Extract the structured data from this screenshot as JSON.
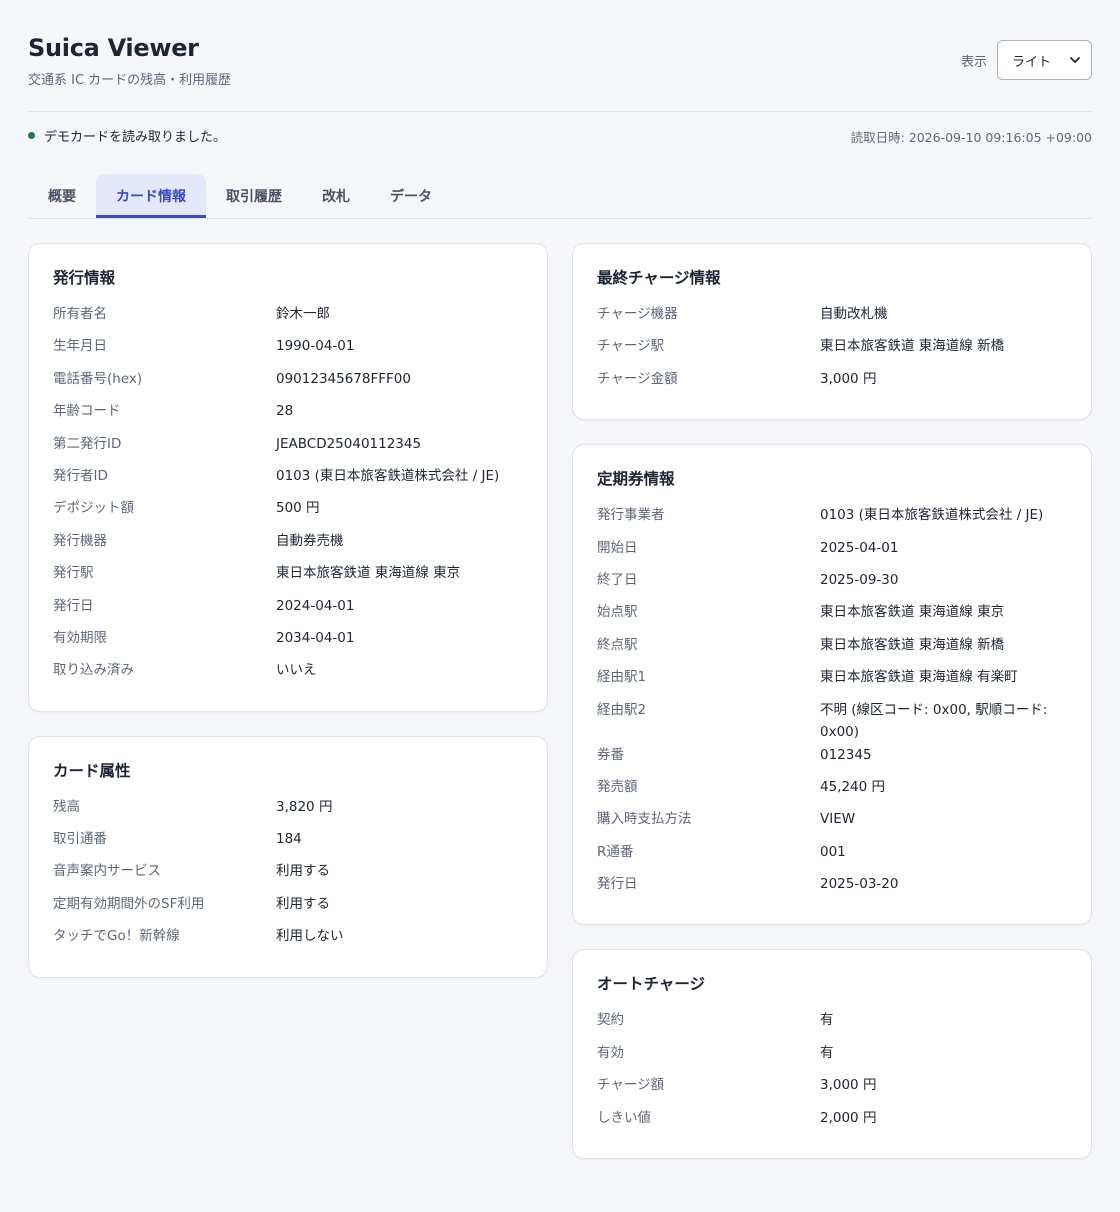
{
  "app": {
    "title": "Suica Viewer",
    "subtitle": "交通系 IC カードの残高・利用履歴"
  },
  "display": {
    "label": "表示",
    "selected": "ライト"
  },
  "status": {
    "message": "デモカードを読み取りました。",
    "read_time": "読取日時: 2026-09-10 09:16:05 +09:00",
    "dot_color": "#1e7a4a"
  },
  "tabs": [
    {
      "label": "概要",
      "active": false
    },
    {
      "label": "カード情報",
      "active": true
    },
    {
      "label": "取引履歴",
      "active": false
    },
    {
      "label": "改札",
      "active": false
    },
    {
      "label": "データ",
      "active": false
    }
  ],
  "accent_color": "#3b4cc0",
  "cards": {
    "issue_info": {
      "title": "発行情報",
      "rows": [
        {
          "label": "所有者名",
          "value": "鈴木一郎"
        },
        {
          "label": "生年月日",
          "value": "1990-04-01"
        },
        {
          "label": "電話番号(hex)",
          "value": "09012345678FFF00"
        },
        {
          "label": "年齢コード",
          "value": "28"
        },
        {
          "label": "第二発行ID",
          "value": "JEABCD25040112345"
        },
        {
          "label": "発行者ID",
          "value": "0103 (東日本旅客鉄道株式会社 / JE)"
        },
        {
          "label": "デポジット額",
          "value": "500 円"
        },
        {
          "label": "発行機器",
          "value": "自動券売機"
        },
        {
          "label": "発行駅",
          "value": "東日本旅客鉄道 東海道線 東京"
        },
        {
          "label": "発行日",
          "value": "2024-04-01"
        },
        {
          "label": "有効期限",
          "value": "2034-04-01"
        },
        {
          "label": "取り込み済み",
          "value": "いいえ"
        }
      ]
    },
    "card_attributes": {
      "title": "カード属性",
      "rows": [
        {
          "label": "残高",
          "value": "3,820 円"
        },
        {
          "label": "取引通番",
          "value": "184"
        },
        {
          "label": "音声案内サービス",
          "value": "利用する"
        },
        {
          "label": "定期有効期間外のSF利用",
          "value": "利用する"
        },
        {
          "label": "タッチでGo！新幹線",
          "value": "利用しない"
        }
      ]
    },
    "last_charge": {
      "title": "最終チャージ情報",
      "rows": [
        {
          "label": "チャージ機器",
          "value": "自動改札機"
        },
        {
          "label": "チャージ駅",
          "value": "東日本旅客鉄道 東海道線 新橋"
        },
        {
          "label": "チャージ金額",
          "value": "3,000 円"
        }
      ]
    },
    "commuter_pass": {
      "title": "定期券情報",
      "rows": [
        {
          "label": "発行事業者",
          "value": "0103 (東日本旅客鉄道株式会社 / JE)"
        },
        {
          "label": "開始日",
          "value": "2025-04-01"
        },
        {
          "label": "終了日",
          "value": "2025-09-30"
        },
        {
          "label": "始点駅",
          "value": "東日本旅客鉄道 東海道線 東京"
        },
        {
          "label": "終点駅",
          "value": "東日本旅客鉄道 東海道線 新橋"
        },
        {
          "label": "経由駅1",
          "value": "東日本旅客鉄道 東海道線 有楽町"
        },
        {
          "label": "経由駅2",
          "value": "不明 (線区コード: 0x00, 駅順コード: 0x00)"
        },
        {
          "label": "券番",
          "value": "012345"
        },
        {
          "label": "発売額",
          "value": "45,240 円"
        },
        {
          "label": "購入時支払方法",
          "value": "VIEW"
        },
        {
          "label": "R通番",
          "value": "001"
        },
        {
          "label": "発行日",
          "value": "2025-03-20"
        }
      ]
    },
    "auto_charge": {
      "title": "オートチャージ",
      "rows": [
        {
          "label": "契約",
          "value": "有"
        },
        {
          "label": "有効",
          "value": "有"
        },
        {
          "label": "チャージ額",
          "value": "3,000 円"
        },
        {
          "label": "しきい値",
          "value": "2,000 円"
        }
      ]
    }
  }
}
